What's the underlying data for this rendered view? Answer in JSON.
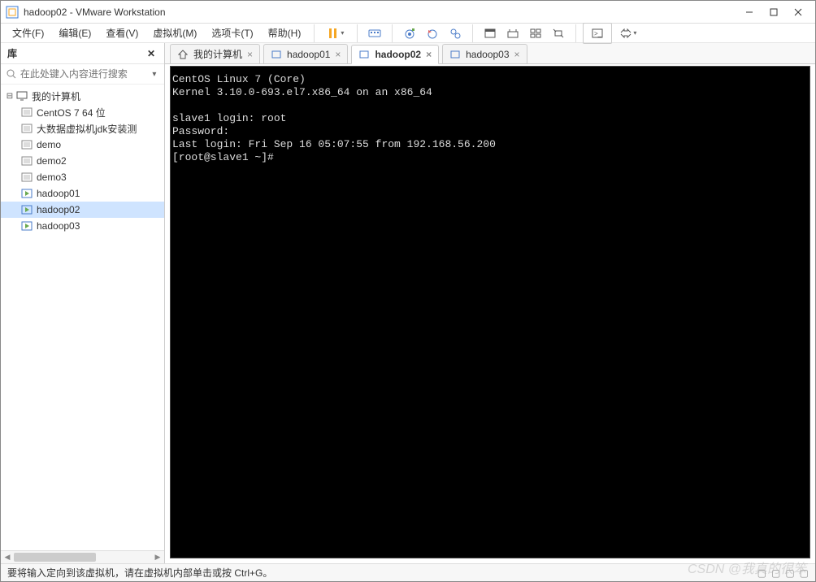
{
  "titlebar": {
    "title": "hadoop02 - VMware Workstation"
  },
  "menubar": {
    "file": "文件(F)",
    "edit": "编辑(E)",
    "view": "查看(V)",
    "vm": "虚拟机(M)",
    "tabs": "选项卡(T)",
    "help": "帮助(H)"
  },
  "sidebar": {
    "title": "库",
    "search_placeholder": "在此处键入内容进行搜索",
    "root": "我的计算机",
    "items": [
      {
        "label": "CentOS 7 64 位"
      },
      {
        "label": "大数据虚拟机jdk安装测"
      },
      {
        "label": "demo"
      },
      {
        "label": "demo2"
      },
      {
        "label": "demo3"
      },
      {
        "label": "hadoop01"
      },
      {
        "label": "hadoop02",
        "selected": true
      },
      {
        "label": "hadoop03"
      }
    ]
  },
  "tabs": [
    {
      "label": "我的计算机",
      "type": "home"
    },
    {
      "label": "hadoop01",
      "type": "vm"
    },
    {
      "label": "hadoop02",
      "type": "vm",
      "active": true
    },
    {
      "label": "hadoop03",
      "type": "vm"
    }
  ],
  "terminal": {
    "lines": [
      "CentOS Linux 7 (Core)",
      "Kernel 3.10.0-693.el7.x86_64 on an x86_64",
      "",
      "slave1 login: root",
      "Password:",
      "Last login: Fri Sep 16 05:07:55 from 192.168.56.200",
      "[root@slave1 ~]#"
    ]
  },
  "statusbar": {
    "hint": "要将输入定向到该虚拟机，请在虚拟机内部单击或按 Ctrl+G。"
  },
  "watermark": "CSDN @我真的很笨"
}
